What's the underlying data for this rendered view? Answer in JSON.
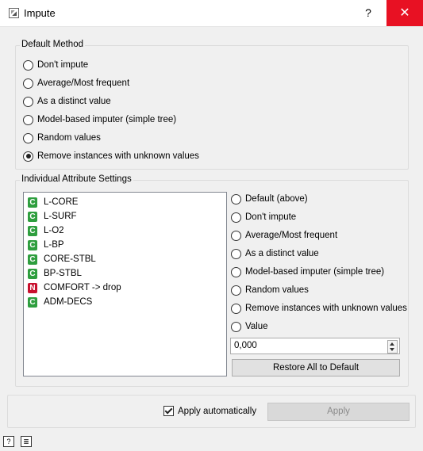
{
  "window": {
    "title": "Impute",
    "help_label": "?",
    "close_label": "✕"
  },
  "default_method": {
    "title": "Default Method",
    "options": [
      {
        "label": "Don't impute",
        "checked": false
      },
      {
        "label": "Average/Most frequent",
        "checked": false
      },
      {
        "label": "As a distinct value",
        "checked": false
      },
      {
        "label": "Model-based imputer (simple tree)",
        "checked": false
      },
      {
        "label": "Random values",
        "checked": false
      },
      {
        "label": "Remove instances with unknown values",
        "checked": true
      }
    ]
  },
  "individual": {
    "title": "Individual Attribute Settings",
    "attributes": [
      {
        "type": "C",
        "color": "#2e9e3e",
        "label": "L-CORE"
      },
      {
        "type": "C",
        "color": "#2e9e3e",
        "label": "L-SURF"
      },
      {
        "type": "C",
        "color": "#2e9e3e",
        "label": "L-O2"
      },
      {
        "type": "C",
        "color": "#2e9e3e",
        "label": "L-BP"
      },
      {
        "type": "C",
        "color": "#2e9e3e",
        "label": "CORE-STBL"
      },
      {
        "type": "C",
        "color": "#2e9e3e",
        "label": "BP-STBL"
      },
      {
        "type": "N",
        "color": "#c8102e",
        "label": "COMFORT -> drop"
      },
      {
        "type": "C",
        "color": "#2e9e3e",
        "label": "ADM-DECS"
      }
    ],
    "options": [
      {
        "label": "Default (above)",
        "checked": false
      },
      {
        "label": "Don't impute",
        "checked": false
      },
      {
        "label": "Average/Most frequent",
        "checked": false
      },
      {
        "label": "As a distinct value",
        "checked": false
      },
      {
        "label": "Model-based imputer (simple tree)",
        "checked": false
      },
      {
        "label": "Random values",
        "checked": false
      },
      {
        "label": "Remove instances with unknown values",
        "checked": false
      },
      {
        "label": "Value",
        "checked": false
      }
    ],
    "value_field": "0,000",
    "restore_label": "Restore All to Default"
  },
  "footer": {
    "apply_auto_label": "Apply automatically",
    "apply_auto_checked": true,
    "apply_label": "Apply"
  },
  "statusbar": {
    "help_icon_glyph": "?",
    "report_icon_glyph": "≣"
  }
}
